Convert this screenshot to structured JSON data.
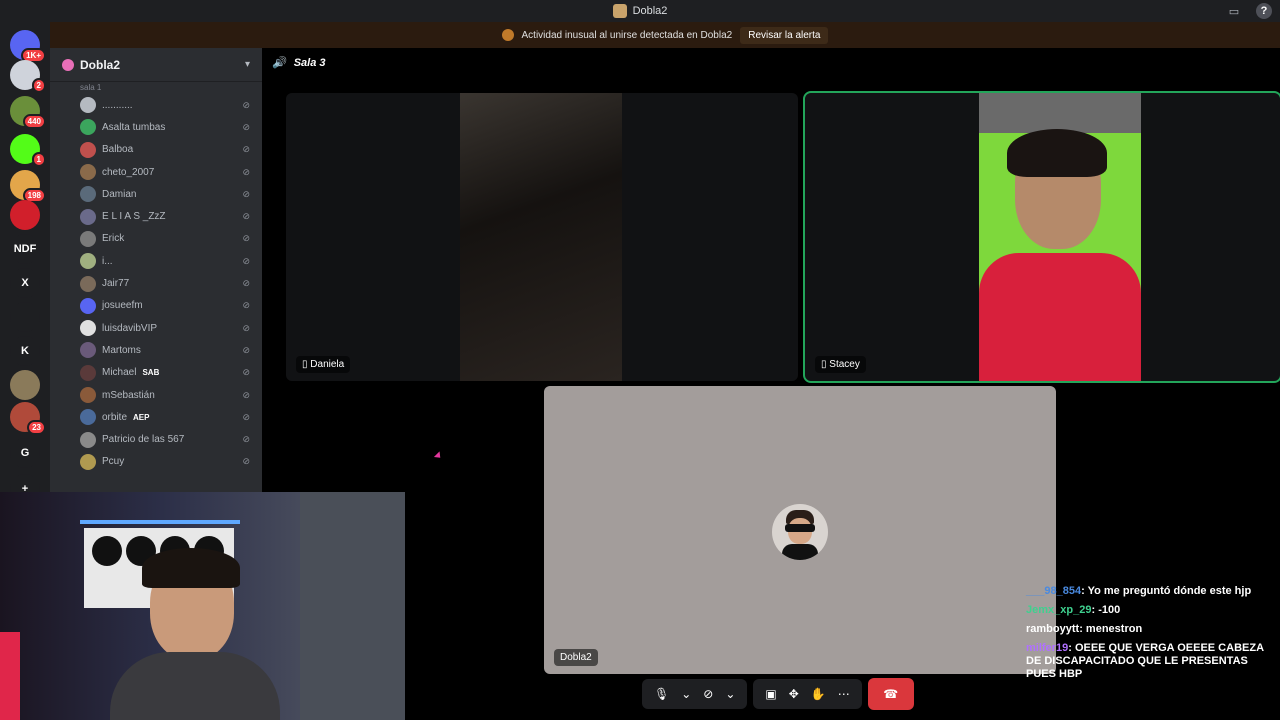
{
  "window": {
    "title": "Dobla2"
  },
  "alert": {
    "text": "Actividad inusual al unirse detectada en Dobla2",
    "action": "Revisar la alerta"
  },
  "servers": [
    {
      "label": "",
      "badge": "1K+",
      "color": "#5865f2"
    },
    {
      "label": "",
      "badge": "2",
      "color": "#cfd3db"
    },
    {
      "label": "",
      "badge": "440",
      "color": "#6a8f3a"
    },
    {
      "label": "",
      "badge": "1",
      "color": "#53fc18"
    },
    {
      "label": "",
      "badge": "198",
      "color": "#e3a64a"
    },
    {
      "label": "",
      "badge": "",
      "color": "#d11f2b"
    },
    {
      "label": "NDF",
      "badge": "",
      "color": "#1e1f22"
    },
    {
      "label": "X",
      "badge": "",
      "color": "#1e1f22"
    },
    {
      "label": "",
      "badge": "",
      "color": "#1e1f22"
    },
    {
      "label": "K",
      "badge": "",
      "color": "#1e1f22"
    },
    {
      "label": "",
      "badge": "",
      "color": "#8a7a5a"
    },
    {
      "label": "",
      "badge": "23",
      "color": "#b04a3a"
    },
    {
      "label": "G",
      "badge": "",
      "color": "#1e1f22"
    },
    {
      "label": "+",
      "badge": "",
      "color": "#1e1f22"
    }
  ],
  "sidebar": {
    "guild_name": "Dobla2",
    "sala_label": "sala 1",
    "members": [
      {
        "name": "...........",
        "tag": "",
        "color": "#b5bac1"
      },
      {
        "name": "Asalta tumbas",
        "tag": "",
        "color": "#3ba55d"
      },
      {
        "name": "Balboa",
        "tag": "",
        "color": "#c0504d"
      },
      {
        "name": "cheto_2007",
        "tag": "",
        "color": "#8a6a4a"
      },
      {
        "name": "Damian",
        "tag": "",
        "color": "#5a6a7a"
      },
      {
        "name": "E L I A S _ZzZ",
        "tag": "",
        "color": "#6a6a8a"
      },
      {
        "name": "Erick",
        "tag": "",
        "color": "#7a7a7a"
      },
      {
        "name": "i...",
        "tag": "",
        "color": "#a0b080"
      },
      {
        "name": "Jair77",
        "tag": "",
        "color": "#7a6a5a"
      },
      {
        "name": "josueefm",
        "tag": "",
        "color": "#5865f2"
      },
      {
        "name": "luisdavibVIP",
        "tag": "",
        "color": "#e0e0e0"
      },
      {
        "name": "Martoms",
        "tag": "",
        "color": "#6a5a7a"
      },
      {
        "name": "Michael",
        "tag": "SAB",
        "color": "#5a3a3a"
      },
      {
        "name": "mSebastián",
        "tag": "",
        "color": "#8a5a3a"
      },
      {
        "name": "orbite",
        "tag": "AEP",
        "color": "#4a6a9a"
      },
      {
        "name": "Patricio de las 567",
        "tag": "",
        "color": "#8a8a8a"
      },
      {
        "name": "Pcuy",
        "tag": "",
        "color": "#b09a50"
      }
    ]
  },
  "voice": {
    "channel_name": "Sala 3",
    "tiles": [
      {
        "name": "Daniela",
        "speaking": false
      },
      {
        "name": "Stacey",
        "speaking": true
      },
      {
        "name": "Dobla2",
        "speaking": false
      }
    ]
  },
  "chat": [
    {
      "user": "___98_854",
      "message": "Yo me preguntó dónde este hjp",
      "color": "#4a8ae0"
    },
    {
      "user": "Jemx_xp_29",
      "message": "-100",
      "color": "#3fd08f"
    },
    {
      "user": "ramboyytt",
      "message": "menestron",
      "color": "#ffffff"
    },
    {
      "user": "milfer19",
      "message": "OEEE QUE VERGA OEEEE CABEZA DE DISCAPACITADO QUE LE PRESENTAS PUES HBP",
      "color": "#b070ff"
    }
  ]
}
